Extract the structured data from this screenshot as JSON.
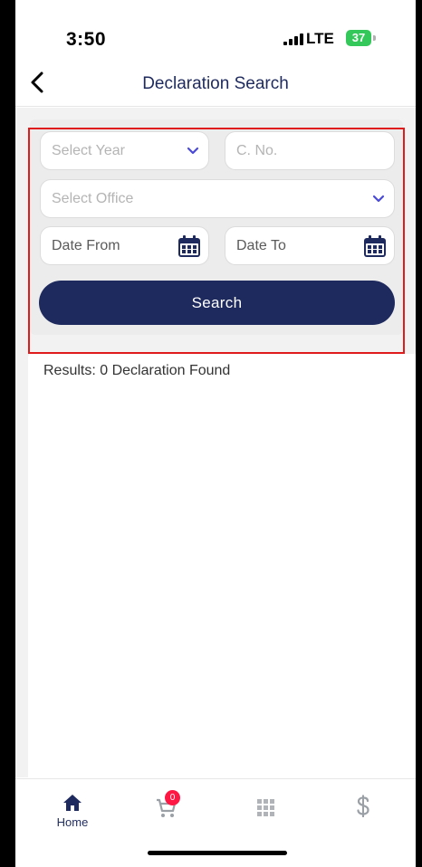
{
  "status_bar": {
    "time": "3:50",
    "network": "LTE",
    "battery": "37"
  },
  "header": {
    "title": "Declaration Search"
  },
  "form": {
    "year_placeholder": "Select Year",
    "cno_placeholder": "C. No.",
    "office_placeholder": "Select Office",
    "date_from_placeholder": "Date From",
    "date_to_placeholder": "Date To",
    "search_label": "Search"
  },
  "results": {
    "text": "Results: 0 Declaration Found"
  },
  "tabbar": {
    "home_label": "Home",
    "cart_badge": "0"
  },
  "colors": {
    "primary": "#1e2a5e",
    "badge": "#ff1744",
    "highlight": "#e01b1b"
  }
}
